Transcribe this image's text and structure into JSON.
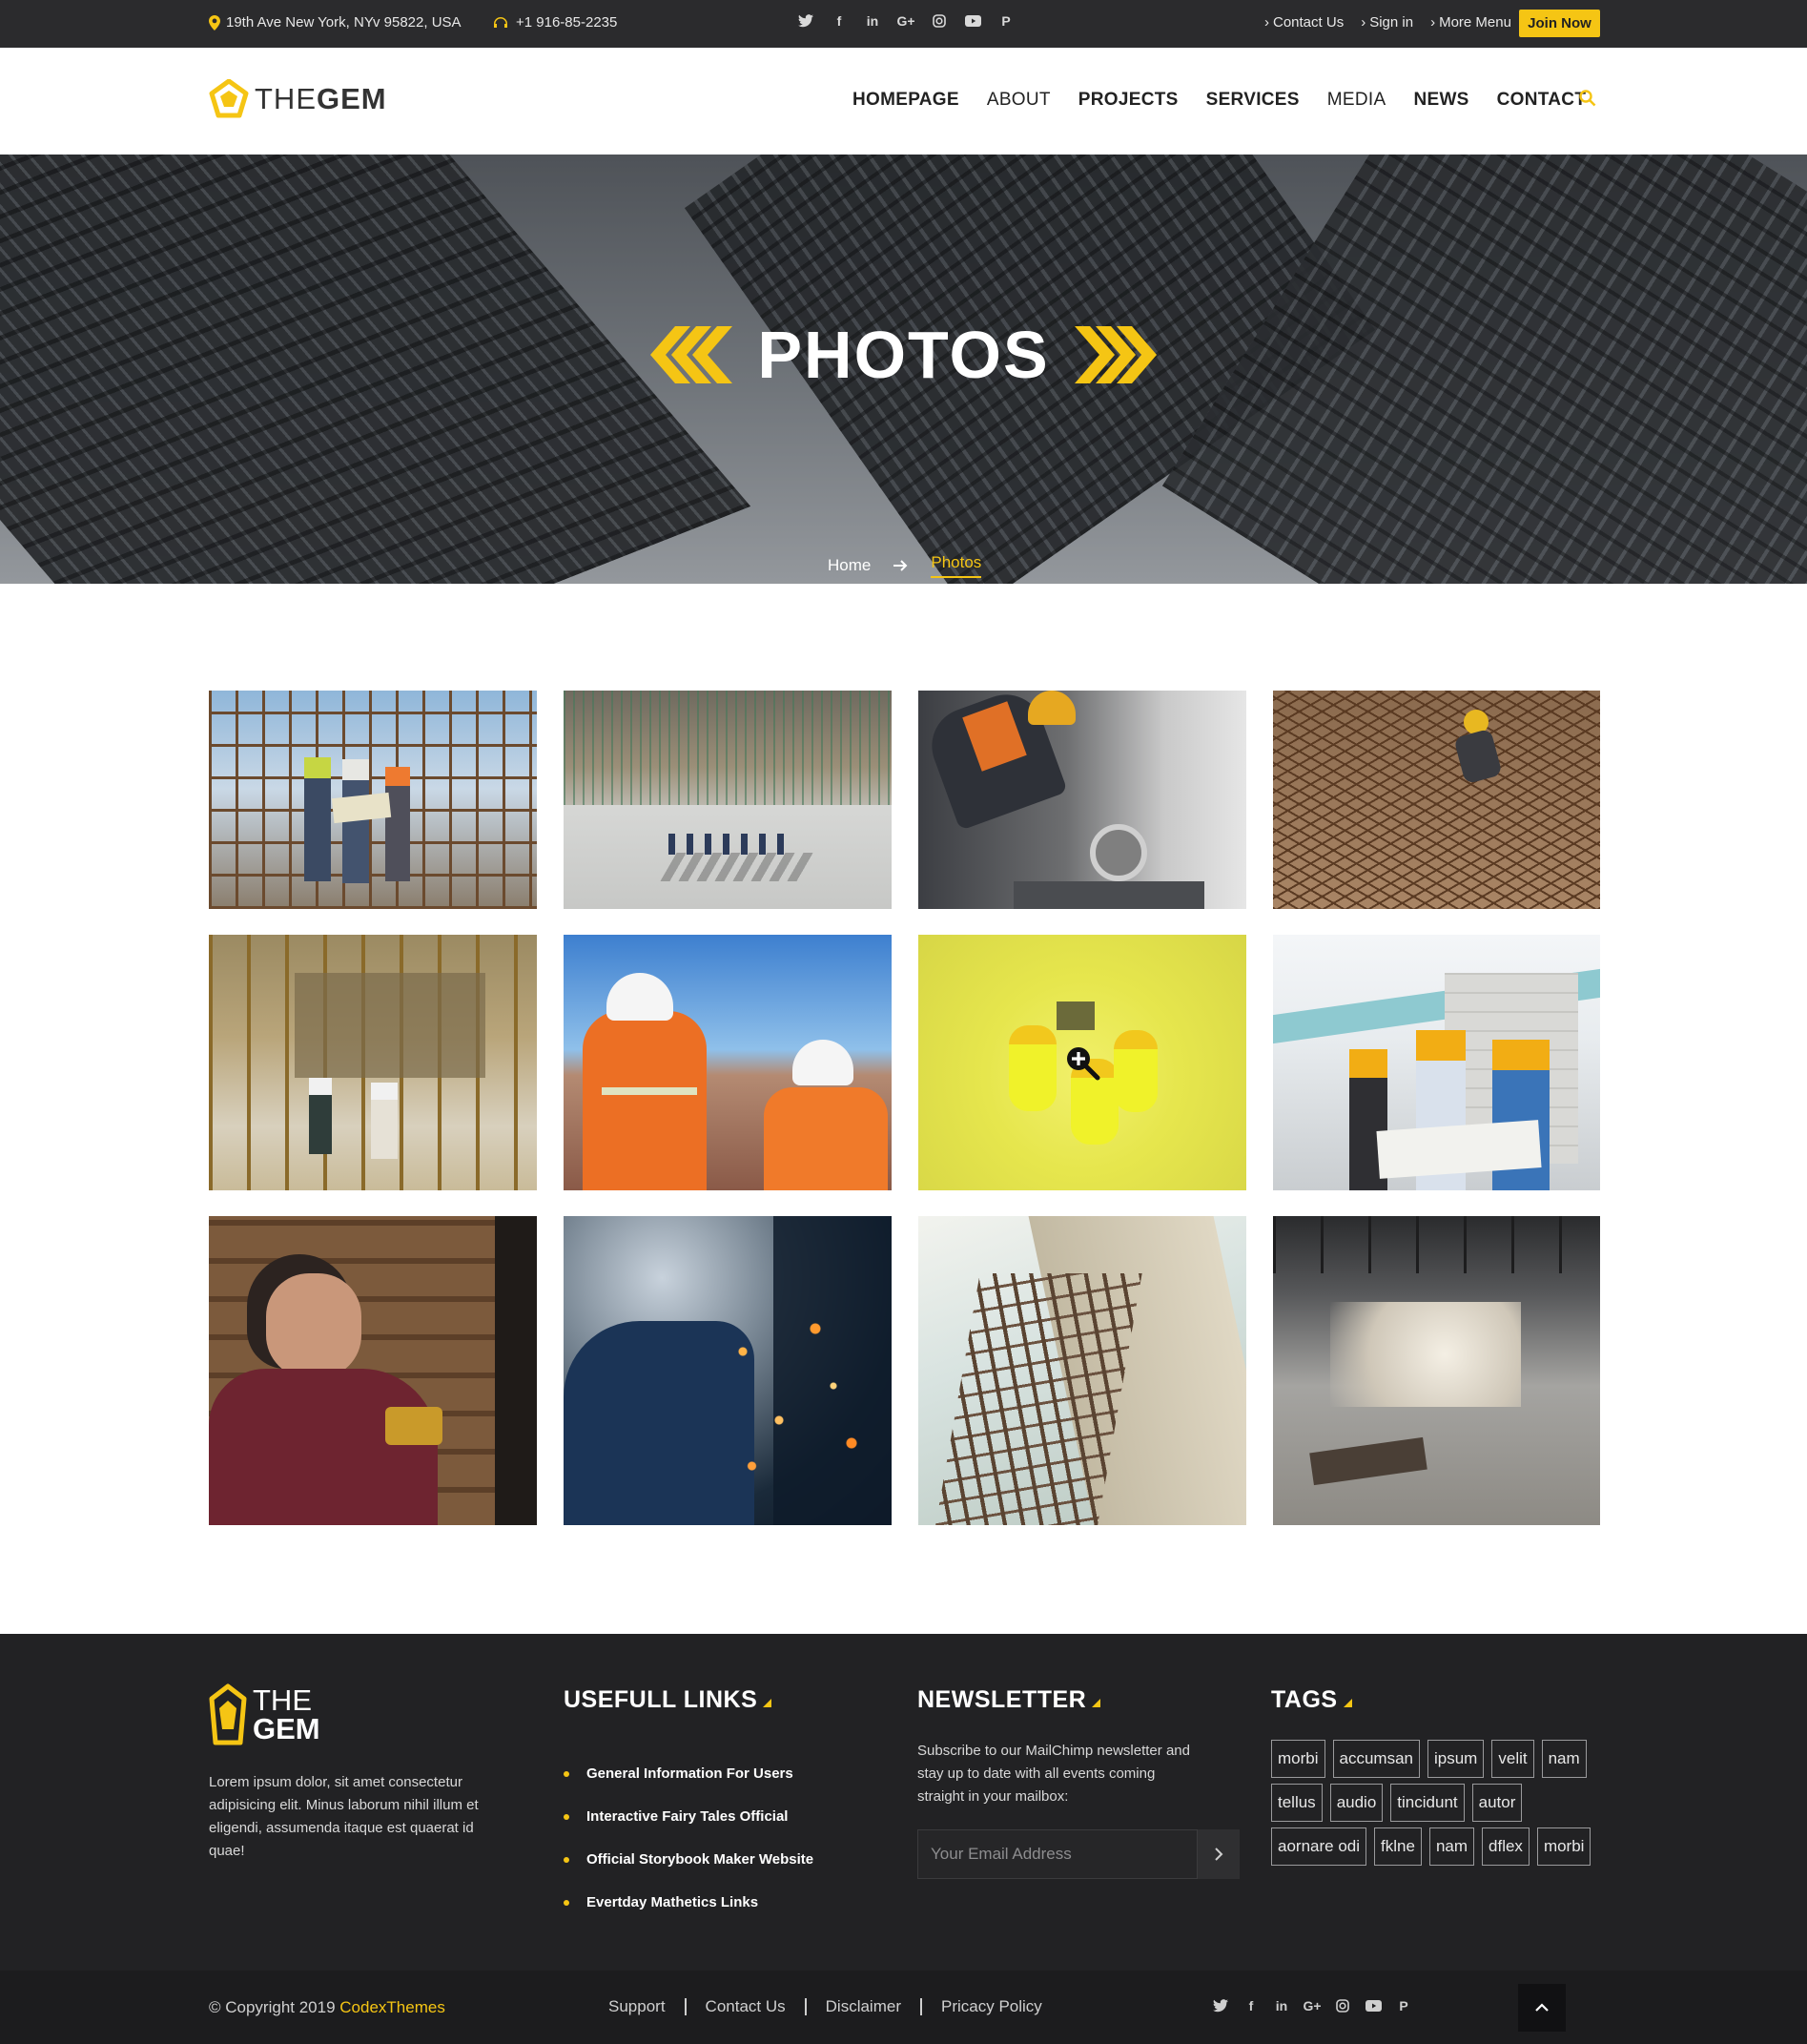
{
  "topbar": {
    "address": "19th Ave New York, NYv 95822, USA",
    "phone": "+1 916-85-2235",
    "social_icons": [
      "twitter-icon",
      "facebook-icon",
      "linkedin-icon",
      "google-plus-icon",
      "instagram-icon",
      "youtube-icon",
      "pinterest-icon"
    ],
    "links": [
      "Contact Us",
      "Sign in",
      "More Menu"
    ],
    "join_label": "Join Now"
  },
  "header": {
    "logo_the": "THE",
    "logo_gem": "GEM",
    "nav": [
      "HOMEPAGE",
      "ABOUT",
      "PROJECTS",
      "SERVICES",
      "MEDIA",
      "NEWS",
      "CONTACT"
    ]
  },
  "hero": {
    "title": "PHOTOS",
    "breadcrumb": {
      "home": "Home",
      "current": "Photos"
    }
  },
  "gallery": {
    "photos": [
      {
        "name": "photo-workers-scaffolding"
      },
      {
        "name": "photo-site-overhead"
      },
      {
        "name": "photo-grinder-worker"
      },
      {
        "name": "photo-rebar-worker"
      },
      {
        "name": "photo-basement-site"
      },
      {
        "name": "photo-engineers-pointing"
      },
      {
        "name": "photo-yellow-team-overhead"
      },
      {
        "name": "photo-blueprint-team"
      },
      {
        "name": "photo-drill-man"
      },
      {
        "name": "photo-welding-sparks"
      },
      {
        "name": "photo-rebar-column"
      },
      {
        "name": "photo-empty-interior"
      }
    ]
  },
  "colors": {
    "accent": "#f5c514",
    "dark": "#222224",
    "topbar": "#2b2b2d"
  },
  "footer": {
    "logo_the": "THE",
    "logo_gem": "GEM",
    "about": "Lorem ipsum dolor, sit amet consectetur adipisicing elit. Minus laborum nihil illum et eligendi, assumenda itaque est quaerat id quae!",
    "links_heading": "USEFULL LINKS",
    "links": [
      "General Information For Users",
      "Interactive Fairy Tales Official",
      "Official Storybook Maker Website",
      "Evertday Mathetics Links"
    ],
    "newsletter_heading": "NEWSLETTER",
    "newsletter_text": "Subscribe to our MailChimp newsletter and stay up to date with all events coming straight in your mailbox:",
    "email_placeholder": "Your Email Address",
    "tags_heading": "TAGS",
    "tags": [
      "morbi",
      "accumsan",
      "ipsum",
      "velit",
      "nam",
      "tellus",
      "audio",
      "tincidunt",
      "autor",
      "aornare odi",
      "fklne",
      "nam",
      "dflex",
      "morbi"
    ]
  },
  "bottom": {
    "copyright": "© Copyright 2019",
    "brand": "CodexThemes",
    "links": [
      "Support",
      "Contact Us",
      "Disclaimer",
      "Pricacy Policy"
    ]
  }
}
